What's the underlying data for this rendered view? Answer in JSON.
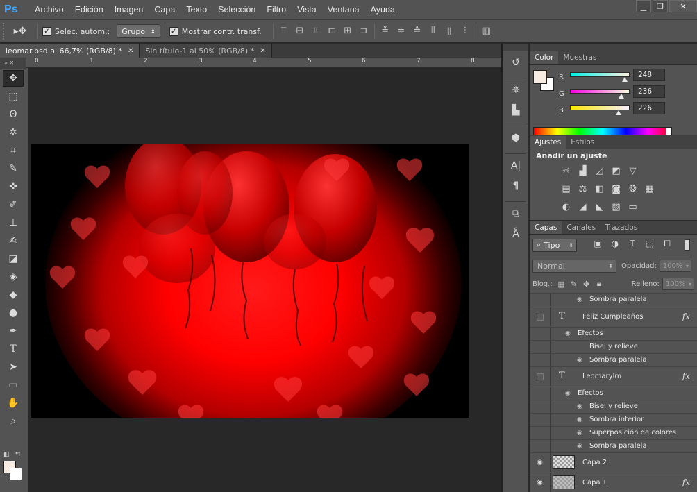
{
  "app": {
    "logo": "Ps"
  },
  "menu": [
    "Archivo",
    "Edición",
    "Imagen",
    "Capa",
    "Texto",
    "Selección",
    "Filtro",
    "Vista",
    "Ventana",
    "Ayuda"
  ],
  "window_controls": {
    "minimize": "▁",
    "restore": "❐",
    "close": "✕"
  },
  "options": {
    "auto_select_label": "Selec. autom.:",
    "auto_select_value": "Grupo",
    "show_transform_label": "Mostrar contr. transf."
  },
  "tabs": [
    {
      "label": "leomar.psd al 66,7% (RGB/8) *",
      "active": true
    },
    {
      "label": "Sin título-1 al 50% (RGB/8) *",
      "active": false
    }
  ],
  "ruler": {
    "ticks": [
      "0",
      "1",
      "2",
      "3",
      "4",
      "5",
      "6",
      "7",
      "8"
    ]
  },
  "colors": {
    "foreground": "#f8ece2",
    "background": "#ffffff",
    "accent": "#ff0000"
  },
  "color_panel": {
    "tabs": [
      "Color",
      "Muestras"
    ],
    "channels": [
      {
        "label": "R",
        "value": "248"
      },
      {
        "label": "G",
        "value": "236"
      },
      {
        "label": "B",
        "value": "226"
      }
    ]
  },
  "adjust_panel": {
    "tabs": [
      "Ajustes",
      "Estilos"
    ],
    "title": "Añadir un ajuste"
  },
  "layers_panel": {
    "tabs": [
      "Capas",
      "Canales",
      "Trazados"
    ],
    "filter_label": "Tipo",
    "blend_mode": "Normal",
    "opacity_label": "Opacidad:",
    "opacity_value": "100%",
    "lock_label": "Bloq.:",
    "fill_label": "Relleno:",
    "fill_value": "100%",
    "rows": [
      {
        "kind": "effect",
        "label": "Sombra paralela"
      },
      {
        "kind": "text-layer",
        "label": "Feliz Cumpleaños",
        "fx": "fx"
      },
      {
        "kind": "effects-header",
        "label": "Efectos"
      },
      {
        "kind": "effect",
        "label": "Bisel y relieve"
      },
      {
        "kind": "effect",
        "label": "Sombra paralela"
      },
      {
        "kind": "text-layer",
        "label": "Leomarylm",
        "fx": "fx"
      },
      {
        "kind": "effects-header",
        "label": "Efectos"
      },
      {
        "kind": "effect",
        "label": "Bisel y relieve"
      },
      {
        "kind": "effect",
        "label": "Sombra interior"
      },
      {
        "kind": "effect",
        "label": "Superposición de colores"
      },
      {
        "kind": "effect",
        "label": "Sombra paralela"
      },
      {
        "kind": "pixel-layer",
        "label": "Capa 2"
      },
      {
        "kind": "pixel-layer",
        "label": "Capa 1",
        "fx": "fx"
      }
    ]
  }
}
